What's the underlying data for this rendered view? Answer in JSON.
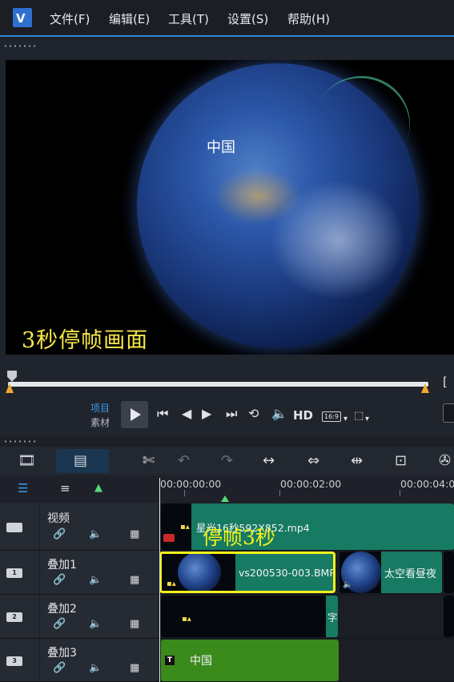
{
  "menu": {
    "logo": "V",
    "items": [
      "文件(F)",
      "编辑(E)",
      "工具(T)",
      "设置(S)",
      "帮助(H)"
    ]
  },
  "preview": {
    "globe_label": "中国",
    "caption": "3秒停帧画面",
    "bracket": "["
  },
  "transport": {
    "mode_project": "项目",
    "mode_clip": "素材",
    "hd_label": "HD",
    "ratio_label": "16:9"
  },
  "toolbar": {
    "icons": [
      "storyboard-view-icon",
      "timeline-view-icon",
      "tools-icon",
      "undo-icon",
      "redo-icon",
      "fit-icon",
      "ripple-icon",
      "split-icon",
      "zoom-icon",
      "film-icon"
    ]
  },
  "ruler": {
    "labels": [
      "00:00:00:00",
      "00:00:02:00",
      "00:00:04:00"
    ]
  },
  "tracks": [
    {
      "name": "视频",
      "badge": ""
    },
    {
      "name": "叠加1",
      "badge": "1"
    },
    {
      "name": "叠加2",
      "badge": "2"
    },
    {
      "name": "叠加3",
      "badge": "3"
    }
  ],
  "clips": {
    "video_main": "星光16秒592X852.mp4",
    "freeze_annotation": "停帧3秒",
    "overlay1_still": "vs200530-003.BMP",
    "overlay1_next": "太空看昼夜",
    "overlay2_tail": "字",
    "overlay3_title": "中国",
    "title_badge": "T"
  },
  "colors": {
    "accent": "#2e8ad6",
    "video_clip": "#177a63",
    "title_clip": "#3a8a1c",
    "highlight": "#f3f21a",
    "caption": "#f7e84a"
  }
}
